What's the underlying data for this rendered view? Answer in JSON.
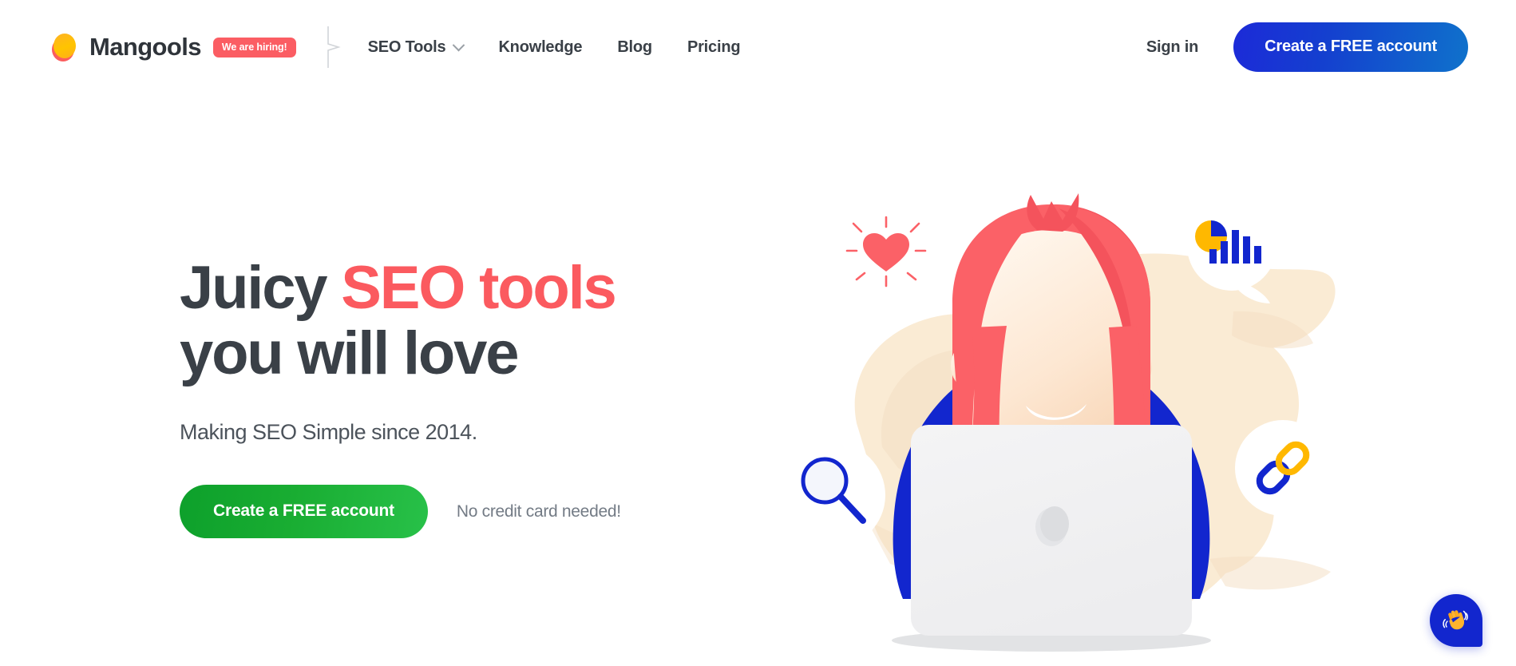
{
  "header": {
    "brand_name": "Mangools",
    "hiring_badge": "We are hiring!",
    "nav_items": [
      {
        "label": "SEO Tools",
        "has_dropdown": true
      },
      {
        "label": "Knowledge",
        "has_dropdown": false
      },
      {
        "label": "Blog",
        "has_dropdown": false
      },
      {
        "label": "Pricing",
        "has_dropdown": false
      }
    ],
    "signin_label": "Sign in",
    "create_account_label": "Create a FREE account"
  },
  "hero": {
    "title_part1": "Juicy ",
    "title_accent": "SEO tools",
    "title_part2": "you will love",
    "subtitle": "Making SEO Simple since 2014.",
    "cta_label": "Create a FREE account",
    "cta_note": "No credit card needed!"
  },
  "illustration": {
    "icons": [
      "heart-icon",
      "magnifier-icon",
      "analytics-chart-icon",
      "link-chain-icon"
    ],
    "subject": "woman-with-laptop"
  },
  "chat": {
    "icon": "waving-hand-icon"
  },
  "colors": {
    "accent_red": "#FB5A5F",
    "text_dark": "#3A4047",
    "brand_blue": "#1226CE",
    "cta_green": "#19AD32",
    "badge_red": "#FB5D63",
    "logo_yellow": "#FFC400",
    "illustration_cream": "#FAEBD4",
    "illustration_blue": "#1226CE",
    "illustration_hair": "#FB6167",
    "illustration_yellow": "#FFB800"
  }
}
